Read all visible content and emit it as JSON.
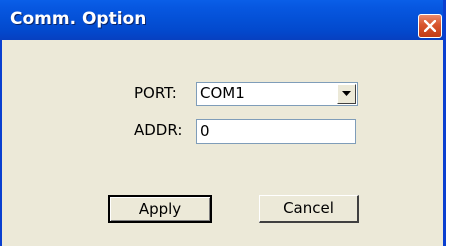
{
  "window": {
    "title": "Comm. Option",
    "accent_color": "#0450d6",
    "close_icon": "close-icon"
  },
  "form": {
    "port_label": "PORT:",
    "port_value": "COM1",
    "addr_label": "ADDR:",
    "addr_value": "0"
  },
  "buttons": {
    "apply_label": "Apply",
    "cancel_label": "Cancel"
  }
}
